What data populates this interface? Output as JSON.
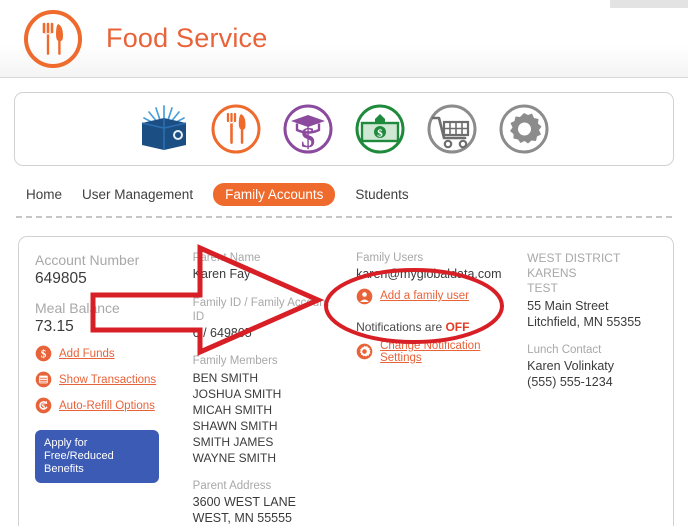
{
  "header": {
    "brand_title": "Food Service",
    "logo_icon": "fork-knife-circle-icon"
  },
  "toolbar": {
    "icons": [
      {
        "name": "wallet-book-icon",
        "label": "Accounts",
        "color": "#1b4f84"
      },
      {
        "name": "fork-knife-icon",
        "label": "Food Service",
        "color": "#ee6b2d"
      },
      {
        "name": "graduation-cap-dollar-icon",
        "label": "Tuition",
        "color": "#8b4a9e"
      },
      {
        "name": "dollar-bill-icon",
        "label": "Payments",
        "color": "#1f8a3c"
      },
      {
        "name": "shopping-cart-icon",
        "label": "Store",
        "color": "#808080"
      },
      {
        "name": "gear-icon",
        "label": "Settings",
        "color": "#808080"
      }
    ]
  },
  "nav": {
    "items": [
      {
        "label": "Home",
        "active": false
      },
      {
        "label": "User Management",
        "active": false
      },
      {
        "label": "Family Accounts",
        "active": true
      },
      {
        "label": "Students",
        "active": false
      }
    ],
    "active_color": "#ee6b2d"
  },
  "account": {
    "account_number_label": "Account Number",
    "account_number_value": "649805",
    "meal_balance_label": "Meal Balance",
    "meal_balance_value": "73.15",
    "links": [
      {
        "label": "Add Funds",
        "icon": "dollar-circle-icon"
      },
      {
        "label": "Show Transactions",
        "icon": "list-circle-icon"
      },
      {
        "label": "Auto-Refill Options",
        "icon": "refill-circle-icon"
      }
    ],
    "apply_button_label": "Apply for Free/Reduced Benefits"
  },
  "family": {
    "parent_name_label": "Parent Name",
    "parent_name_value": "Karen Fay",
    "family_id_label": "Family ID / Family Account ID",
    "family_id_value": "6 / 649805",
    "family_members_label": "Family Members",
    "family_members": [
      "BEN SMITH",
      "JOSHUA SMITH",
      "MICAH SMITH",
      "SHAWN SMITH",
      "SMITH JAMES",
      "WAYNE SMITH"
    ],
    "parent_address_label": "Parent Address",
    "parent_address_lines": [
      "3600 WEST LANE",
      "WEST, MN 55555"
    ]
  },
  "family_users": {
    "label": "Family Users",
    "email": "karen@myglobaldata.com",
    "add_user_label": "Add a family user",
    "add_user_icon": "person-circle-icon",
    "notifications_prefix": "Notifications are ",
    "notifications_state": "OFF",
    "notifications_state_color": "#e23b24",
    "change_settings_label": "Change Notification Settings",
    "change_settings_icon": "gear-circle-icon"
  },
  "district": {
    "name_lines": [
      "WEST DISTRICT KARENS",
      "TEST"
    ],
    "address_lines": [
      "55 Main Street",
      "Litchfield, MN 55355"
    ],
    "lunch_contact_label": "Lunch Contact",
    "lunch_contact_name": "Karen Volinkaty",
    "lunch_contact_phone": "(555) 555-1234"
  },
  "annotations": {
    "color": "#d81f26",
    "arrow_name": "red-arrow-annotation",
    "ellipse_name": "red-ellipse-annotation"
  }
}
